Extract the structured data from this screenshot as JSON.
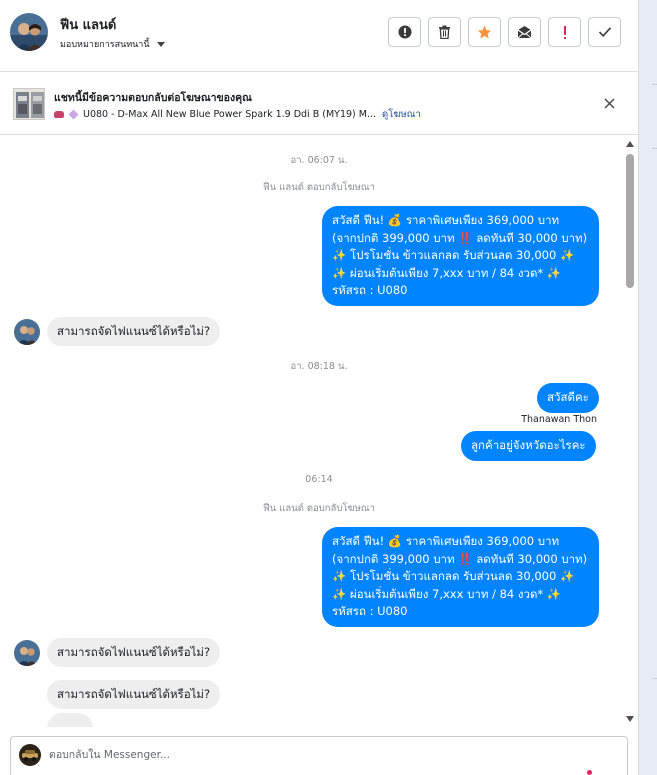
{
  "header": {
    "contact_name": "ฟีน แลนด์",
    "assign_label": "มอบหมายการสนทนานี้",
    "actions": [
      {
        "name": "mark-spam-button",
        "icon": "alert-circle-icon"
      },
      {
        "name": "delete-button",
        "icon": "trash-icon"
      },
      {
        "name": "star-button",
        "icon": "star-icon"
      },
      {
        "name": "mark-unread-button",
        "icon": "envelope-icon"
      },
      {
        "name": "follow-up-button",
        "icon": "exclamation-icon"
      },
      {
        "name": "mark-done-button",
        "icon": "checkmark-icon"
      }
    ],
    "colors": {
      "star": "#f7923a",
      "follow_up": "#e0245e"
    }
  },
  "ad_banner": {
    "title": "แชทนี้มีข้อความตอบกลับต่อโฆษณาของคุณ",
    "subtitle": "U080 - D-Max All New Blue Power Spark 1.9 Ddi B (MY19) M...",
    "link": "ดูโฆษณา",
    "close_icon": "close-icon"
  },
  "conversation": {
    "messages": [
      {
        "type": "timestamp",
        "text": "อา. 06:07 น."
      },
      {
        "type": "note",
        "text": "ฟีน แลนด์ ตอบกลับโฆษณา"
      },
      {
        "type": "outgoing",
        "lines": [
          "สวัสดี ฟีน! 💰 ราคาพิเศษเพียง 369,000 บาท",
          "(จากปกติ 399,000 บาท ‼️ ลดทันที 30,000 บาท)",
          "✨ โปรโมชั่น ข้าวแลกลด รับส่วนลด 30,000 ✨",
          "✨ ผ่อนเริ่มต้นเพียง 7,xxx บาท / 84 งวด* ✨",
          "รหัสรถ : U080"
        ]
      },
      {
        "type": "incoming",
        "text": "สามารถจัดไฟแนนซ์ได้หรือไม่?"
      },
      {
        "type": "timestamp",
        "text": "อา. 08:18 น."
      },
      {
        "type": "outgoing",
        "text": "สวัสดีคะ"
      },
      {
        "type": "sender",
        "text": "Thanawan Thon"
      },
      {
        "type": "outgoing",
        "text": "ลูกค้าอยู่จังหวัดอะไรคะ"
      },
      {
        "type": "timestamp",
        "text": "06:14"
      },
      {
        "type": "note",
        "text": "ฟีน แลนด์ ตอบกลับโฆษณา"
      },
      {
        "type": "outgoing",
        "lines": [
          "สวัสดี ฟีน! 💰 ราคาพิเศษเพียง 369,000 บาท",
          "(จากปกติ 399,000 บาท ‼️ ลดทันที 30,000 บาท)",
          "✨ โปรโมชั่น ข้าวแลกลด รับส่วนลด 30,000 ✨",
          "✨ ผ่อนเริ่มต้นเพียง 7,xxx บาท / 84 งวด* ✨",
          "รหัสรถ : U080"
        ]
      },
      {
        "type": "incoming",
        "text": "สามารถจัดไฟแนนซ์ได้หรือไม่?"
      },
      {
        "type": "incoming",
        "text": "สามารถจัดไฟแนนซ์ได้หรือไม่?"
      }
    ],
    "colors": {
      "outgoing_bubble": "#0084ff",
      "incoming_bubble": "#eeeeee"
    }
  },
  "composer": {
    "placeholder": "ตอบกลับใน Messenger..."
  }
}
